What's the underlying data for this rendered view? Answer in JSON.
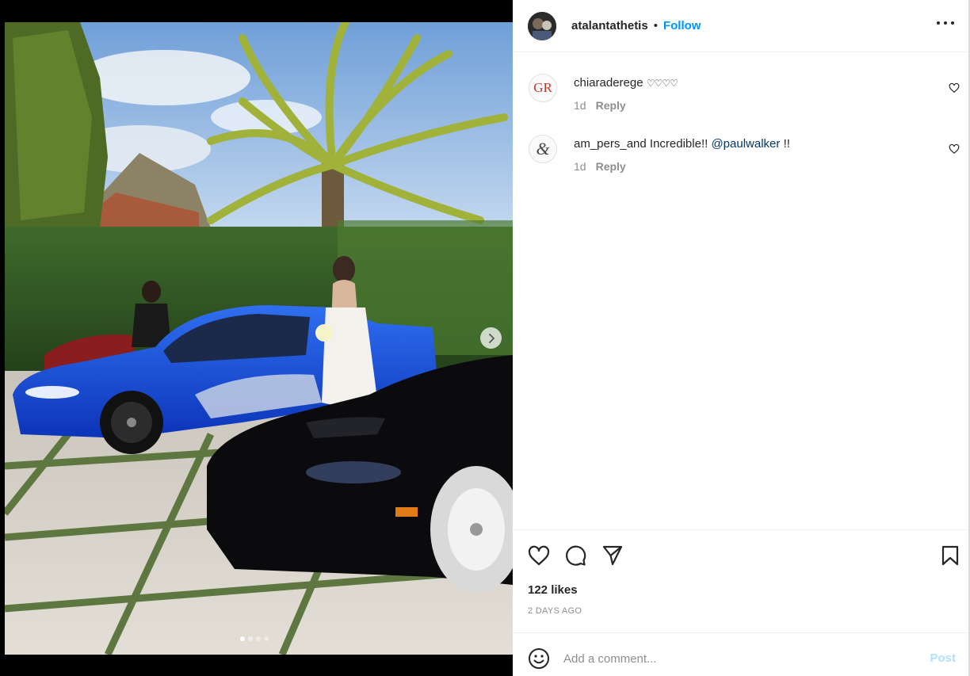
{
  "post": {
    "author": "atalantathetis",
    "separator": "•",
    "follow_label": "Follow",
    "more_icon": "more-horizontal-icon"
  },
  "media": {
    "description_icon": "carousel-next-icon",
    "carousel": {
      "total": 4,
      "active_index": 0
    }
  },
  "comments": [
    {
      "avatar_text": "GR",
      "username": "chiaraderege",
      "text": "",
      "decoration": "♡♡♡♡",
      "mention": "",
      "suffix": "",
      "age": "1d",
      "reply_label": "Reply"
    },
    {
      "avatar_text": "&",
      "username": "am_pers_and",
      "text": "Incredible!!",
      "mention": "@paulwalker",
      "suffix": "!!",
      "age": "1d",
      "reply_label": "Reply"
    }
  ],
  "actions": {
    "like_icon": "heart-icon",
    "comment_icon": "comment-icon",
    "share_icon": "send-icon",
    "save_icon": "bookmark-icon",
    "likes_text": "122 likes",
    "time_ago": "2 DAYS AGO"
  },
  "composer": {
    "emoji_icon": "emoji-icon",
    "placeholder": "Add a comment...",
    "post_label": "Post"
  },
  "colors": {
    "accent": "#0095f6",
    "mention": "#00376b",
    "post_disabled": "#b2dffc",
    "muted": "#8e8e8e"
  }
}
